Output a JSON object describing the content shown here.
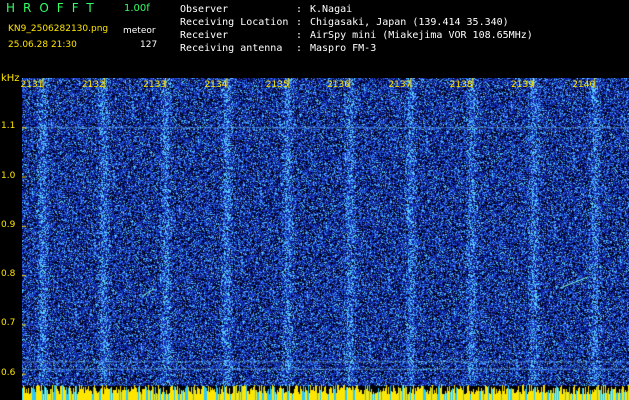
{
  "header": {
    "app_name": "HROFFT",
    "version": "1.00f",
    "filename": "KN9_2506282130.png",
    "program": "meteor",
    "datetime": "25.06.28 21:30",
    "count": "127"
  },
  "info": [
    {
      "key": "Observer",
      "value": "K.Nagai"
    },
    {
      "key": "Receiving Location",
      "value": "Chigasaki, Japan (139.414 35.340)"
    },
    {
      "key": "Receiver",
      "value": "AirSpy mini (Miakejima VOR 108.65MHz)"
    },
    {
      "key": "Receiving antenna",
      "value": "Maspro FM-3"
    }
  ],
  "spectrogram": {
    "y_unit": "kHz",
    "y_ticks": [
      "1.1",
      "1.0",
      "0.9",
      "0.8",
      "0.7",
      "0.6"
    ],
    "x_ticks": [
      "2131",
      "2132",
      "2133",
      "2134",
      "2135",
      "2136",
      "2137",
      "2138",
      "2139",
      "2140"
    ],
    "y_range": [
      0.575,
      1.2
    ],
    "x_range": [
      2130.6,
      2140.5
    ],
    "colors": {
      "background": "#000000",
      "noise_low": "#0a1a8c",
      "noise_mid": "#2850d8",
      "noise_high": "#5fd0ff",
      "tick": "#ffe600",
      "baseline": "#ffe600"
    }
  }
}
